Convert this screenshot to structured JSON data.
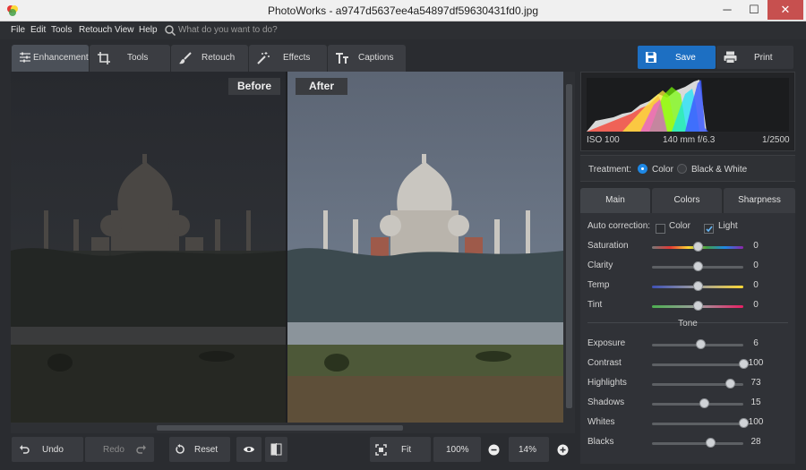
{
  "window": {
    "title": "PhotoWorks - a9747d5637ee4a54897df59630431fd0.jpg",
    "minimize": "─",
    "maximize": "☐",
    "close": "✕"
  },
  "menu": {
    "items": [
      "File",
      "Edit",
      "Tools",
      "Retouch",
      "View",
      "Help"
    ],
    "search_placeholder": "What do you want to do?"
  },
  "tabs": [
    {
      "label": "Enhancement",
      "icon": "sliders-icon",
      "active": true
    },
    {
      "label": "Tools",
      "icon": "crop-icon"
    },
    {
      "label": "Retouch",
      "icon": "brush-icon"
    },
    {
      "label": "Effects",
      "icon": "magic-wand-icon"
    },
    {
      "label": "Captions",
      "icon": "text-icon"
    }
  ],
  "actions": {
    "save": "Save",
    "print": "Print"
  },
  "preview": {
    "before_label": "Before",
    "after_label": "After"
  },
  "bottom": {
    "undo": "Undo",
    "redo": "Redo",
    "reset": "Reset",
    "fit": "Fit",
    "zoom_100": "100%",
    "zoom_value": "14%"
  },
  "exif": {
    "iso": "ISO 100",
    "lens": "140 mm f/6.3",
    "shutter": "1/2500"
  },
  "treatment": {
    "label": "Treatment:",
    "color": "Color",
    "bw": "Black & White",
    "selected": "Color"
  },
  "panel_tabs": [
    {
      "label": "Main",
      "active": true
    },
    {
      "label": "Colors"
    },
    {
      "label": "Sharpness"
    }
  ],
  "auto_correction": {
    "label": "Auto correction:",
    "color": "Color",
    "light": "Light",
    "color_checked": false,
    "light_checked": true
  },
  "color_sliders": [
    {
      "label": "Saturation",
      "value": "0",
      "level": 0.5,
      "track": "rainbow"
    },
    {
      "label": "Clarity",
      "value": "0",
      "level": 0.5,
      "track": "plain"
    },
    {
      "label": "Temp",
      "value": "0",
      "level": 0.5,
      "track": "temp"
    },
    {
      "label": "Tint",
      "value": "0",
      "level": 0.5,
      "track": "tint"
    }
  ],
  "tone_label": "Tone",
  "tone_sliders": [
    {
      "label": "Exposure",
      "value": "6",
      "level": 0.53
    },
    {
      "label": "Contrast",
      "value": "100",
      "level": 1.0
    },
    {
      "label": "Highlights",
      "value": "73",
      "level": 0.86
    },
    {
      "label": "Shadows",
      "value": "15",
      "level": 0.57
    },
    {
      "label": "Whites",
      "value": "100",
      "level": 1.0
    },
    {
      "label": "Blacks",
      "value": "28",
      "level": 0.64
    }
  ],
  "colors": {
    "accent": "#1d6fc2",
    "panel": "#303237",
    "background": "#2a2c30"
  }
}
